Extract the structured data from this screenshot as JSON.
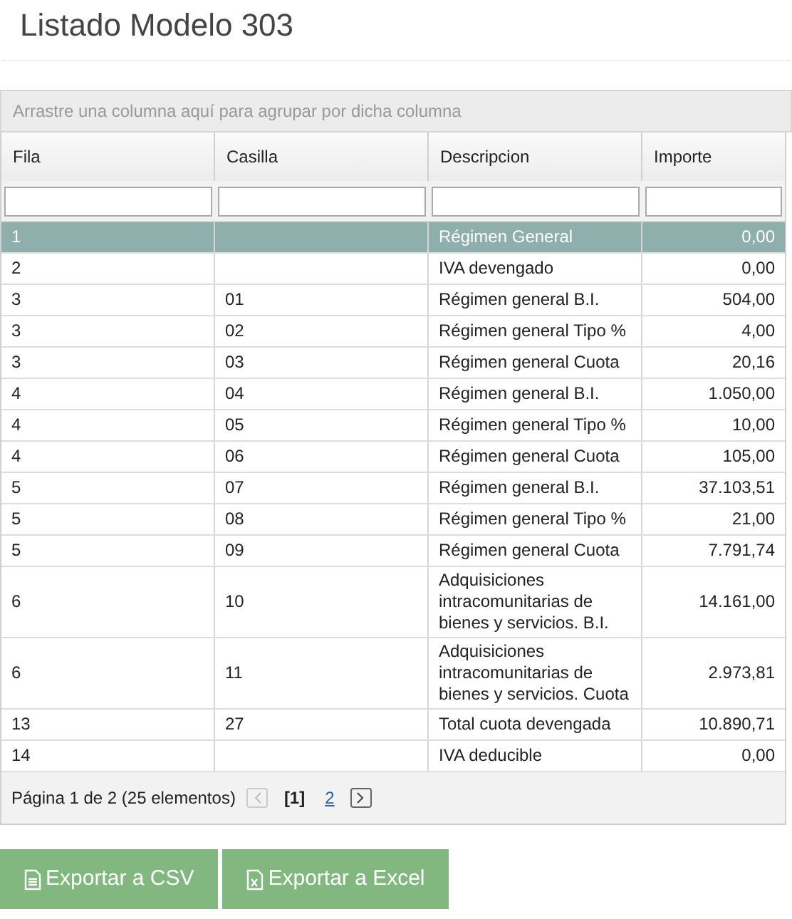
{
  "title": "Listado Modelo 303",
  "group_panel": {
    "hint": "Arrastre una columna aquí para agrupar por dicha columna"
  },
  "table": {
    "columns": [
      "Fila",
      "Casilla",
      "Descripcion",
      "Importe"
    ],
    "rows": [
      {
        "cells": [
          "1",
          "",
          "Régimen General",
          "0,00"
        ],
        "selected": true
      },
      {
        "cells": [
          "2",
          "",
          "IVA devengado",
          "0,00"
        ],
        "selected": false
      },
      {
        "cells": [
          "3",
          "01",
          "Régimen general B.I.",
          "504,00"
        ],
        "selected": false
      },
      {
        "cells": [
          "3",
          "02",
          "Régimen general Tipo %",
          "4,00"
        ],
        "selected": false
      },
      {
        "cells": [
          "3",
          "03",
          "Régimen general Cuota",
          "20,16"
        ],
        "selected": false
      },
      {
        "cells": [
          "4",
          "04",
          "Régimen general B.I.",
          "1.050,00"
        ],
        "selected": false
      },
      {
        "cells": [
          "4",
          "05",
          "Régimen general Tipo %",
          "10,00"
        ],
        "selected": false
      },
      {
        "cells": [
          "4",
          "06",
          "Régimen general Cuota",
          "105,00"
        ],
        "selected": false
      },
      {
        "cells": [
          "5",
          "07",
          "Régimen general B.I.",
          "37.103,51"
        ],
        "selected": false
      },
      {
        "cells": [
          "5",
          "08",
          "Régimen general Tipo %",
          "21,00"
        ],
        "selected": false
      },
      {
        "cells": [
          "5",
          "09",
          "Régimen general Cuota",
          "7.791,74"
        ],
        "selected": false
      },
      {
        "cells": [
          "6",
          "10",
          "Adquisiciones intracomunitarias de bienes y servicios. B.I.",
          "14.161,00"
        ],
        "selected": false
      },
      {
        "cells": [
          "6",
          "11",
          "Adquisiciones intracomunitarias de bienes y servicios. Cuota",
          "2.973,81"
        ],
        "selected": false
      },
      {
        "cells": [
          "13",
          "27",
          "Total cuota devengada",
          "10.890,71"
        ],
        "selected": false
      },
      {
        "cells": [
          "14",
          "",
          "IVA deducible",
          "0,00"
        ],
        "selected": false
      }
    ]
  },
  "pager": {
    "info": "Página 1 de 2 (25 elementos)",
    "prev": {
      "disabled": true
    },
    "pages": [
      {
        "label": "[1]",
        "selected": true
      },
      {
        "label": "2",
        "selected": false
      }
    ],
    "next": {
      "disabled": false
    }
  },
  "buttons": [
    {
      "label": "Exportar a CSV",
      "kind": "csv"
    },
    {
      "label": "Exportar a Excel",
      "kind": "excel"
    }
  ]
}
